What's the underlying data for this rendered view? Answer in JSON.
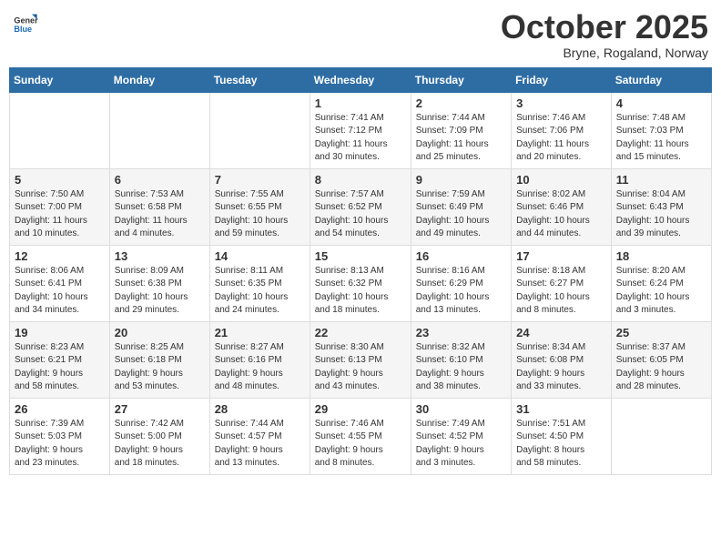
{
  "logo": {
    "general": "General",
    "blue": "Blue"
  },
  "title": "October 2025",
  "location": "Bryne, Rogaland, Norway",
  "days_of_week": [
    "Sunday",
    "Monday",
    "Tuesday",
    "Wednesday",
    "Thursday",
    "Friday",
    "Saturday"
  ],
  "weeks": [
    [
      {
        "day": "",
        "content": ""
      },
      {
        "day": "",
        "content": ""
      },
      {
        "day": "",
        "content": ""
      },
      {
        "day": "1",
        "content": "Sunrise: 7:41 AM\nSunset: 7:12 PM\nDaylight: 11 hours\nand 30 minutes."
      },
      {
        "day": "2",
        "content": "Sunrise: 7:44 AM\nSunset: 7:09 PM\nDaylight: 11 hours\nand 25 minutes."
      },
      {
        "day": "3",
        "content": "Sunrise: 7:46 AM\nSunset: 7:06 PM\nDaylight: 11 hours\nand 20 minutes."
      },
      {
        "day": "4",
        "content": "Sunrise: 7:48 AM\nSunset: 7:03 PM\nDaylight: 11 hours\nand 15 minutes."
      }
    ],
    [
      {
        "day": "5",
        "content": "Sunrise: 7:50 AM\nSunset: 7:00 PM\nDaylight: 11 hours\nand 10 minutes."
      },
      {
        "day": "6",
        "content": "Sunrise: 7:53 AM\nSunset: 6:58 PM\nDaylight: 11 hours\nand 4 minutes."
      },
      {
        "day": "7",
        "content": "Sunrise: 7:55 AM\nSunset: 6:55 PM\nDaylight: 10 hours\nand 59 minutes."
      },
      {
        "day": "8",
        "content": "Sunrise: 7:57 AM\nSunset: 6:52 PM\nDaylight: 10 hours\nand 54 minutes."
      },
      {
        "day": "9",
        "content": "Sunrise: 7:59 AM\nSunset: 6:49 PM\nDaylight: 10 hours\nand 49 minutes."
      },
      {
        "day": "10",
        "content": "Sunrise: 8:02 AM\nSunset: 6:46 PM\nDaylight: 10 hours\nand 44 minutes."
      },
      {
        "day": "11",
        "content": "Sunrise: 8:04 AM\nSunset: 6:43 PM\nDaylight: 10 hours\nand 39 minutes."
      }
    ],
    [
      {
        "day": "12",
        "content": "Sunrise: 8:06 AM\nSunset: 6:41 PM\nDaylight: 10 hours\nand 34 minutes."
      },
      {
        "day": "13",
        "content": "Sunrise: 8:09 AM\nSunset: 6:38 PM\nDaylight: 10 hours\nand 29 minutes."
      },
      {
        "day": "14",
        "content": "Sunrise: 8:11 AM\nSunset: 6:35 PM\nDaylight: 10 hours\nand 24 minutes."
      },
      {
        "day": "15",
        "content": "Sunrise: 8:13 AM\nSunset: 6:32 PM\nDaylight: 10 hours\nand 18 minutes."
      },
      {
        "day": "16",
        "content": "Sunrise: 8:16 AM\nSunset: 6:29 PM\nDaylight: 10 hours\nand 13 minutes."
      },
      {
        "day": "17",
        "content": "Sunrise: 8:18 AM\nSunset: 6:27 PM\nDaylight: 10 hours\nand 8 minutes."
      },
      {
        "day": "18",
        "content": "Sunrise: 8:20 AM\nSunset: 6:24 PM\nDaylight: 10 hours\nand 3 minutes."
      }
    ],
    [
      {
        "day": "19",
        "content": "Sunrise: 8:23 AM\nSunset: 6:21 PM\nDaylight: 9 hours\nand 58 minutes."
      },
      {
        "day": "20",
        "content": "Sunrise: 8:25 AM\nSunset: 6:18 PM\nDaylight: 9 hours\nand 53 minutes."
      },
      {
        "day": "21",
        "content": "Sunrise: 8:27 AM\nSunset: 6:16 PM\nDaylight: 9 hours\nand 48 minutes."
      },
      {
        "day": "22",
        "content": "Sunrise: 8:30 AM\nSunset: 6:13 PM\nDaylight: 9 hours\nand 43 minutes."
      },
      {
        "day": "23",
        "content": "Sunrise: 8:32 AM\nSunset: 6:10 PM\nDaylight: 9 hours\nand 38 minutes."
      },
      {
        "day": "24",
        "content": "Sunrise: 8:34 AM\nSunset: 6:08 PM\nDaylight: 9 hours\nand 33 minutes."
      },
      {
        "day": "25",
        "content": "Sunrise: 8:37 AM\nSunset: 6:05 PM\nDaylight: 9 hours\nand 28 minutes."
      }
    ],
    [
      {
        "day": "26",
        "content": "Sunrise: 7:39 AM\nSunset: 5:03 PM\nDaylight: 9 hours\nand 23 minutes."
      },
      {
        "day": "27",
        "content": "Sunrise: 7:42 AM\nSunset: 5:00 PM\nDaylight: 9 hours\nand 18 minutes."
      },
      {
        "day": "28",
        "content": "Sunrise: 7:44 AM\nSunset: 4:57 PM\nDaylight: 9 hours\nand 13 minutes."
      },
      {
        "day": "29",
        "content": "Sunrise: 7:46 AM\nSunset: 4:55 PM\nDaylight: 9 hours\nand 8 minutes."
      },
      {
        "day": "30",
        "content": "Sunrise: 7:49 AM\nSunset: 4:52 PM\nDaylight: 9 hours\nand 3 minutes."
      },
      {
        "day": "31",
        "content": "Sunrise: 7:51 AM\nSunset: 4:50 PM\nDaylight: 8 hours\nand 58 minutes."
      },
      {
        "day": "",
        "content": ""
      }
    ]
  ]
}
